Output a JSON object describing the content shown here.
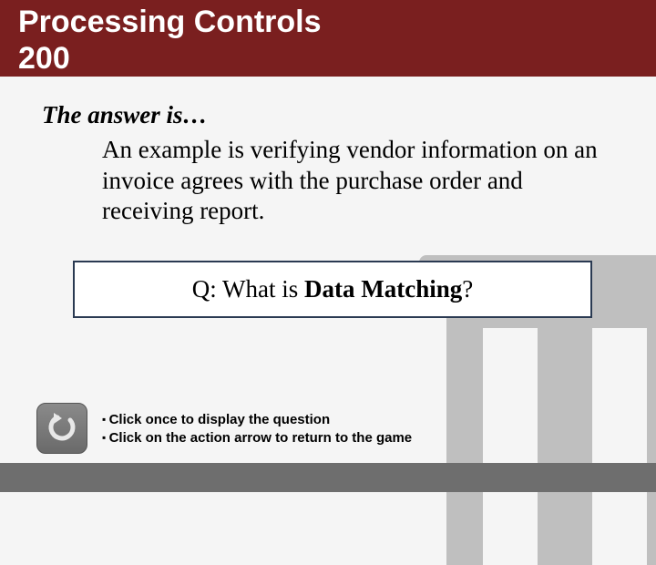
{
  "header": {
    "category": "Processing Controls",
    "points": "200"
  },
  "answer": {
    "lead": "The answer is…",
    "body": "An example is verifying vendor information on an invoice agrees with the purchase order and receiving report."
  },
  "question": {
    "prefix": "Q: What is ",
    "term": "Data Matching",
    "suffix": "?"
  },
  "instructions": {
    "line1": "Click once to display the question",
    "line2": "Click on the action arrow to return to the game"
  },
  "icons": {
    "action_arrow": "return-arrow-icon"
  },
  "colors": {
    "brand": "#7a1f1f",
    "border": "#2a3a52",
    "footer": "#6e6e6e"
  },
  "chart_data": null
}
